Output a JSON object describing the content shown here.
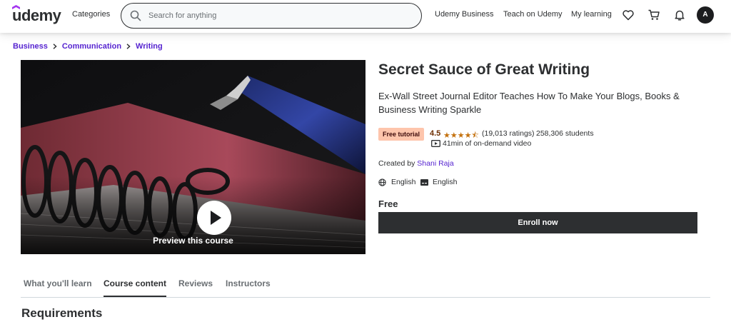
{
  "header": {
    "logo": "udemy",
    "categories_label": "Categories",
    "search_placeholder": "Search for anything",
    "links": [
      "Udemy Business",
      "Teach on Udemy",
      "My learning"
    ],
    "avatar_initial": "A",
    "icons": [
      "search-icon",
      "heart-icon",
      "cart-icon",
      "bell-icon"
    ]
  },
  "breadcrumb": [
    "Business",
    "Communication",
    "Writing"
  ],
  "preview": {
    "label": "Preview this course"
  },
  "course": {
    "title": "Secret Sauce of Great Writing",
    "subtitle": "Ex-Wall Street Journal Editor Teaches How To Make Your Blogs, Books & Business Writing Sparkle",
    "badge": "Free tutorial",
    "rating": "4.5",
    "stars": "★★★★⯪",
    "rating_count": "(19,013 ratings)",
    "students": "258,306 students",
    "video_length": "41min of on-demand video",
    "created_by_label": "Created by",
    "instructor": "Shani Raja",
    "language": "English",
    "captions": "English",
    "price": "Free",
    "enroll_label": "Enroll now"
  },
  "tabs": [
    {
      "label": "What you'll learn",
      "active": false
    },
    {
      "label": "Course content",
      "active": true
    },
    {
      "label": "Reviews",
      "active": false
    },
    {
      "label": "Instructors",
      "active": false
    }
  ],
  "section_heading": "Requirements",
  "colors": {
    "accent": "#5624d0",
    "dark": "#2d2f31",
    "badge_bg": "#fec5ac",
    "rating": "#c4710d"
  }
}
